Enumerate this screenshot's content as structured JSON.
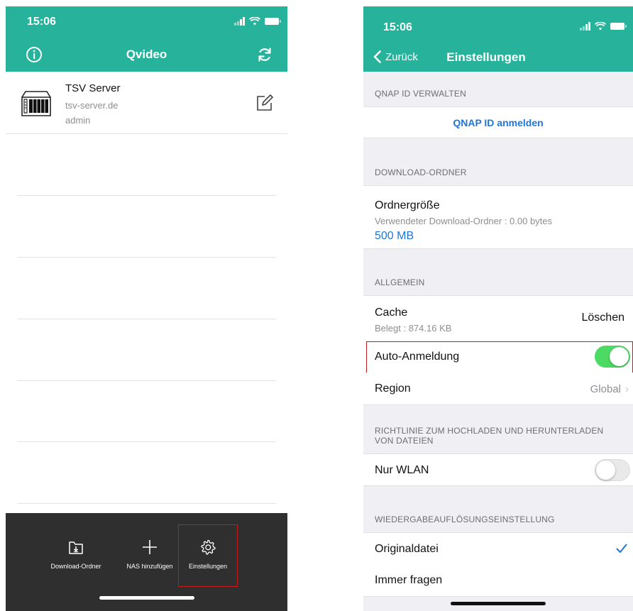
{
  "left": {
    "status_time": "15:06",
    "nav_title": "Qvideo",
    "server": {
      "name": "TSV Server",
      "host": "tsv-server.de",
      "user": "admin"
    },
    "tabs": [
      {
        "label": "Download-Ordner",
        "icon": "download-folder-icon"
      },
      {
        "label": "NAS hinzufügen",
        "icon": "plus-icon"
      },
      {
        "label": "Einstellungen",
        "icon": "gear-icon"
      }
    ],
    "colors": {
      "header": "#27b39b",
      "tabbar": "#2f2f2f",
      "highlight": "#c41c1c"
    }
  },
  "right": {
    "status_time": "15:06",
    "back_label": "Zurück",
    "title": "Einstellungen",
    "sections": {
      "qnap": {
        "header": "QNAP ID VERWALTEN",
        "link": "QNAP ID anmelden"
      },
      "download": {
        "header": "DOWNLOAD-ORDNER",
        "label": "Ordnergröße",
        "sub": "Verwendeter Download-Ordner : 0.00 bytes",
        "value": "500 MB"
      },
      "general": {
        "header": "ALLGEMEIN",
        "cache_label": "Cache",
        "cache_sub": "Belegt : 874.16 KB",
        "cache_action": "Löschen",
        "auto_login_label": "Auto-Anmeldung",
        "auto_login_on": true,
        "region_label": "Region",
        "region_value": "Global"
      },
      "policy": {
        "header_line1": "RICHTLINIE ZUM HOCHLADEN UND HERUNTERLADEN",
        "header_line2": "VON DATEIEN",
        "wlan_label": "Nur WLAN",
        "wlan_on": false
      },
      "playback": {
        "header": "WIEDERGABEAUFLÖSUNGSEINSTELLUNG",
        "option1": "Originaldatei",
        "option1_selected": true,
        "option2": "Immer fragen"
      }
    },
    "colors": {
      "link": "#1e76d8",
      "toggle_on": "#4cd964",
      "check": "#1e76d8"
    }
  }
}
